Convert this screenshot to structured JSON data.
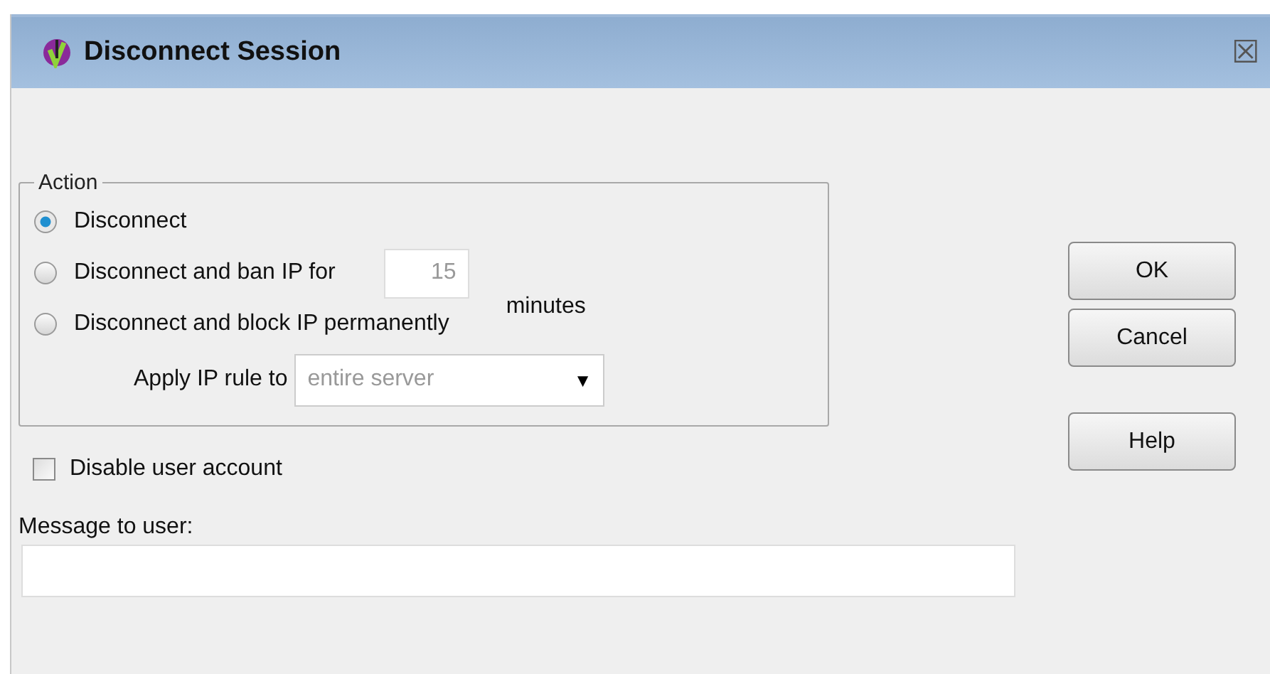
{
  "window": {
    "title": "Disconnect Session",
    "close": "☒"
  },
  "action_group": {
    "legend": "Action",
    "options": [
      {
        "label": "Disconnect",
        "selected": true
      },
      {
        "label": "Disconnect and ban IP for",
        "selected": false
      },
      {
        "label": "Disconnect and block IP permanently",
        "selected": false
      }
    ],
    "ban_minutes": {
      "value": "15",
      "unit": "minutes"
    },
    "apply_rule": {
      "label": "Apply IP rule to",
      "value": "entire server",
      "arrow": "▼"
    }
  },
  "disable_account": {
    "label": "Disable user account",
    "checked": false
  },
  "message": {
    "label": "Message to user:"
  },
  "buttons": [
    "OK",
    "Cancel",
    "Help"
  ]
}
